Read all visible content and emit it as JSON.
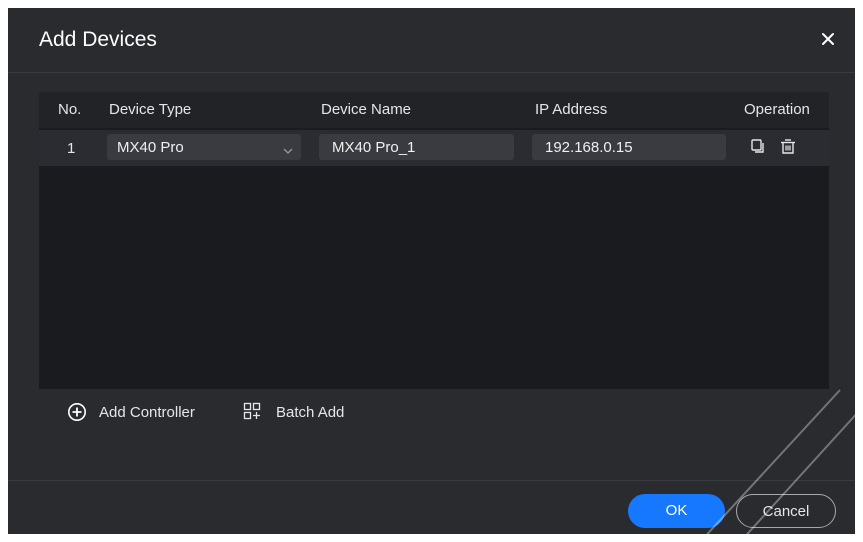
{
  "dialog": {
    "title": "Add Devices",
    "close_icon": "close-icon"
  },
  "table": {
    "columns": [
      "No.",
      "Device Type",
      "Device Name",
      "IP Address",
      "Operation"
    ],
    "rows": [
      {
        "no": "1",
        "device_type": "MX40 Pro",
        "device_name": "MX40 Pro_1",
        "ip_address": "192.168.0.15",
        "operations": [
          "copy-icon",
          "delete-icon"
        ]
      }
    ]
  },
  "actions": {
    "add_controller": "Add Controller",
    "batch_add": "Batch Add"
  },
  "footer": {
    "ok": "OK",
    "cancel": "Cancel"
  },
  "colors": {
    "dialog_bg": "#2a2b2f",
    "table_bg": "#1a1b1e",
    "row_bg": "#2b2c31",
    "input_bg": "#3a3b40",
    "primary": "#1677ff"
  }
}
